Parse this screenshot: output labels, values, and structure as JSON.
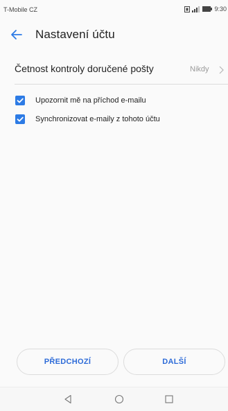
{
  "status_bar": {
    "carrier": "T-Mobile CZ",
    "time": "9:30"
  },
  "header": {
    "title": "Nastavení účtu"
  },
  "settings": {
    "check_frequency": {
      "label": "Četnost kontroly doručené pošty",
      "value": "Nikdy"
    },
    "options": [
      {
        "label": "Upozornit mě na příchod e-mailu",
        "checked": true
      },
      {
        "label": "Synchronizovat e-maily z tohoto účtu",
        "checked": true
      }
    ]
  },
  "buttons": {
    "previous": "PŘEDCHOZÍ",
    "next": "DALŠÍ"
  },
  "colors": {
    "accent": "#2d7be5",
    "button_text": "#2d6bd8",
    "secondary_text": "#9a9a9a"
  },
  "icons": {
    "back": "arrow-left-icon",
    "chevron": "chevron-right-icon",
    "checkbox": "checkbox-checked-icon",
    "nav_back": "triangle-back-icon",
    "nav_home": "circle-home-icon",
    "nav_recent": "square-recent-icon"
  }
}
